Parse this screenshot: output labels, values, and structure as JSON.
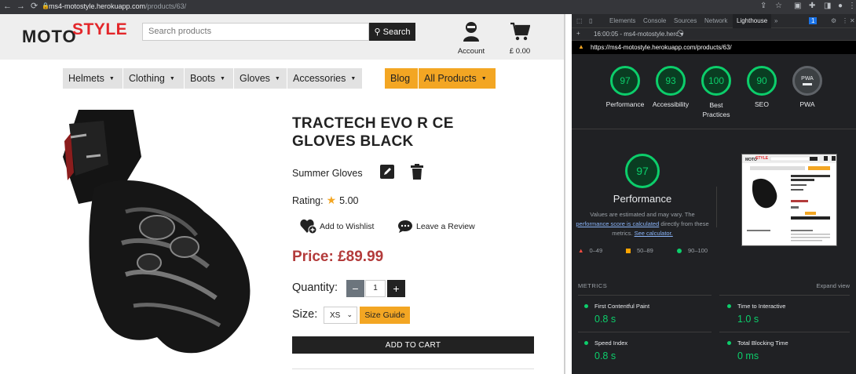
{
  "browser": {
    "url_host": "ms4-motostyle.herokuapp.com",
    "url_path": "/products/63/"
  },
  "site": {
    "logo_left": "MOTO",
    "logo_right": "STYLE",
    "search": {
      "placeholder": "Search products",
      "button": "Search"
    },
    "account_label": "Account",
    "cart_total": "£ 0.00",
    "nav": [
      {
        "label": "Helmets"
      },
      {
        "label": "Clothing"
      },
      {
        "label": "Boots"
      },
      {
        "label": "Gloves"
      },
      {
        "label": "Accessories"
      }
    ],
    "nav_blog": "Blog",
    "nav_all_products": "All Products"
  },
  "product": {
    "title": "TRACTECH EVO R CE GLOVES BLACK",
    "category": "Summer Gloves",
    "rating_label": "Rating:",
    "rating_value": "5.00",
    "wishlist": "Add to Wishlist",
    "review": "Leave a Review",
    "price": "Price: £89.99",
    "quantity_label": "Quantity:",
    "quantity_value": "1",
    "size_label": "Size:",
    "size_value": "XS",
    "size_guide": "Size Guide",
    "add_to_cart": "ADD TO CART"
  },
  "devtools": {
    "tabs": [
      "Elements",
      "Console",
      "Sources",
      "Network",
      "Lighthouse"
    ],
    "active_tab": "Lighthouse",
    "issues_count": "1",
    "report_label": "16:00:05 - ms4-motostyle.herc",
    "report_url": "https://ms4-motostyle.herokuapp.com/products/63/",
    "scores": [
      {
        "value": "97",
        "label": "Performance"
      },
      {
        "value": "93",
        "label": "Accessibility"
      },
      {
        "value": "100",
        "label": "Best Practices"
      },
      {
        "value": "90",
        "label": "SEO"
      },
      {
        "value": "PWA",
        "label": "PWA"
      }
    ],
    "perf_score": "97",
    "perf_title": "Performance",
    "perf_note_1": "Values are estimated and may vary. The",
    "perf_note_link": "performance score is calculated",
    "perf_note_2": "directly from these",
    "perf_note_3": "metrics.",
    "perf_note_link2": "See calculator.",
    "legend": [
      "0–49",
      "50–89",
      "90–100"
    ],
    "metrics_heading": "METRICS",
    "expand_view": "Expand view",
    "metrics": [
      {
        "name": "First Contentful Paint",
        "value": "0.8 s"
      },
      {
        "name": "Time to Interactive",
        "value": "1.0 s"
      },
      {
        "name": "Speed Index",
        "value": "0.8 s"
      },
      {
        "name": "Total Blocking Time",
        "value": "0 ms"
      }
    ],
    "thumb_title": "TRACTECH EVO R CE GLOVES BLACK",
    "thumb_reviews": "Reviews from customers",
    "thumb_desc": "Product Description"
  },
  "colors": {
    "brand_red": "#e3262a",
    "accent_orange": "#f3a623",
    "price_red": "#b33b3b",
    "score_green": "#0cce6b"
  }
}
